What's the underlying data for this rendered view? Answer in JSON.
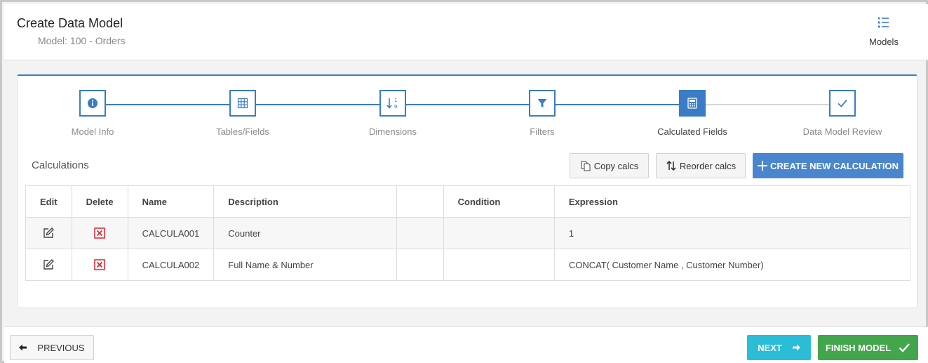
{
  "header": {
    "title": "Create Data Model",
    "subtitle": "Model: 100 - Orders",
    "models_label": "Models",
    "models_icon": "list-numbered-icon"
  },
  "stepper": {
    "steps": [
      {
        "label": "Model Info",
        "icon": "info-icon",
        "state": "done"
      },
      {
        "label": "Tables/Fields",
        "icon": "grid-icon",
        "state": "done"
      },
      {
        "label": "Dimensions",
        "icon": "sort-numeric-icon",
        "state": "done"
      },
      {
        "label": "Filters",
        "icon": "filter-icon",
        "state": "done"
      },
      {
        "label": "Calculated Fields",
        "icon": "calculator-icon",
        "state": "active"
      },
      {
        "label": "Data Model Review",
        "icon": "check-icon",
        "state": "pending"
      }
    ]
  },
  "calculations": {
    "title": "Calculations",
    "copy_label": "Copy calcs",
    "reorder_label": "Reorder calcs",
    "create_label": "CREATE NEW CALCULATION"
  },
  "table": {
    "headers": {
      "edit": "Edit",
      "delete": "Delete",
      "name": "Name",
      "description": "Description",
      "blank": "",
      "condition": "Condition",
      "expression": "Expression"
    },
    "rows": [
      {
        "name": "CALCULA001",
        "description": "Counter",
        "blank": "",
        "condition": "",
        "expression": "1"
      },
      {
        "name": "CALCULA002",
        "description": "Full Name & Number",
        "blank": "",
        "condition": "",
        "expression": "CONCAT( Customer Name , Customer Number)"
      }
    ]
  },
  "footer": {
    "previous_label": "PREVIOUS",
    "next_label": "NEXT",
    "finish_label": "FINISH MODEL"
  },
  "colors": {
    "accent": "#3a7cc6",
    "primary_button": "#4a86cd",
    "next_button": "#2bbdd8",
    "finish_button": "#44a64c",
    "delete_icon": "#e0242c"
  }
}
